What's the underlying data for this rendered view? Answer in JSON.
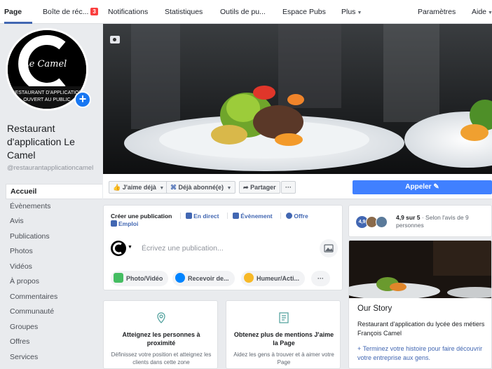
{
  "topnav": {
    "page": "Page",
    "inbox": "Boîte de réc...",
    "inbox_badge": "3",
    "notifications": "Notifications",
    "statistics": "Statistiques",
    "tools": "Outils de pu...",
    "ads": "Espace Pubs",
    "more": "Plus",
    "settings": "Paramètres",
    "help": "Aide"
  },
  "profile": {
    "name": "Restaurant d'application Le Camel",
    "handle": "@restaurantapplicationcamel",
    "logo_letter": "C",
    "logo_script": "Le Camel",
    "logo_line1": "RESTAURANT D'APPLICATION",
    "logo_line2": "OUVERT AU PUBLIC"
  },
  "sidebar": {
    "items": [
      "Accueil",
      "Évènements",
      "Avis",
      "Publications",
      "Photos",
      "Vidéos",
      "À propos",
      "Commentaires",
      "Communauté",
      "Groupes",
      "Offres",
      "Services"
    ]
  },
  "actions": {
    "like": "J'aime déjà",
    "follow": "Déjà abonné(e)",
    "share": "Partager",
    "more": "···",
    "call": "Appeler"
  },
  "composer": {
    "tabs": [
      "Créer une publication",
      "En direct",
      "Évènement",
      "Offre",
      "Emploi"
    ],
    "placeholder": "Écrivez une publication...",
    "buttons": [
      "Photo/Vidéo",
      "Recevoir de...",
      "Humeur/Acti...",
      "···"
    ]
  },
  "promos": [
    {
      "title": "Atteignez les personnes à proximité",
      "desc": "Définissez votre position et atteignez les clients dans cette zone"
    },
    {
      "title": "Obtenez plus de mentions J'aime la Page",
      "desc": "Aidez les gens à trouver et à aimer votre Page"
    }
  ],
  "rating": {
    "badge": "4,9",
    "score": "4,9 sur 5",
    "text": " · Selon l'avis de 9 personnes"
  },
  "story": {
    "title": "Our Story",
    "text": "Restaurant d'application du lycée des métiers François Camel",
    "link": "+ Terminez votre histoire pour faire découvrir votre entreprise aux gens."
  },
  "colors": {
    "brand_blue": "#4267b2",
    "call_blue": "#4080ff",
    "badge_red": "#fa3e3e"
  }
}
